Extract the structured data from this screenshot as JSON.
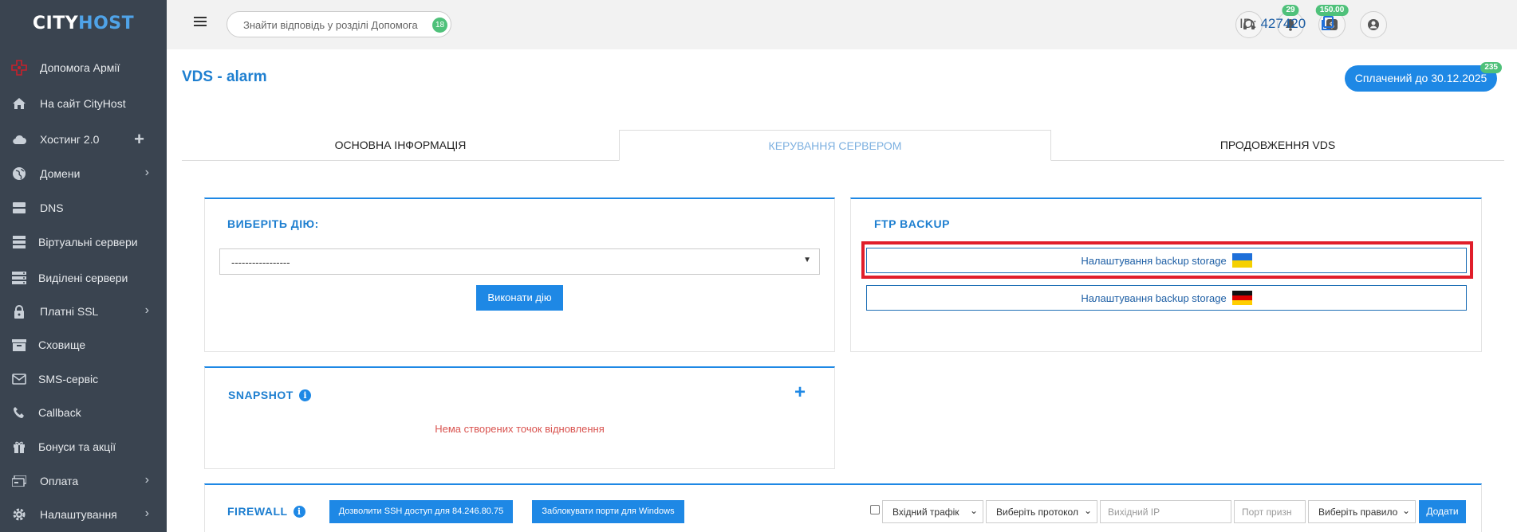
{
  "brand": {
    "part1": "CITY",
    "part2": "HOST"
  },
  "sidebar": {
    "items": [
      {
        "label": "Допомога Армії",
        "icon": "army-cross-icon"
      },
      {
        "label": "На сайт CityHost",
        "icon": "home-icon"
      },
      {
        "label": "Хостинг 2.0",
        "icon": "cloud-icon"
      },
      {
        "label": "Домени",
        "icon": "globe-icon"
      },
      {
        "label": "DNS",
        "icon": "dns-server-icon"
      },
      {
        "label": "Віртуальні сервери",
        "icon": "server-icon"
      },
      {
        "label": "Виділені сервери",
        "icon": "dedicated-server-icon"
      },
      {
        "label": "Платні SSL",
        "icon": "lock-icon"
      },
      {
        "label": "Сховище",
        "icon": "archive-box-icon"
      },
      {
        "label": "SMS-сервіс",
        "icon": "envelope-icon"
      },
      {
        "label": "Callback",
        "icon": "phone-icon"
      },
      {
        "label": "Бонуси та акції",
        "icon": "gift-icon"
      },
      {
        "label": "Оплата",
        "icon": "payment-icon"
      },
      {
        "label": "Налаштування",
        "icon": "gear-icon"
      }
    ]
  },
  "topbar": {
    "search_placeholder": "Знайти відповідь у розділі Допомога",
    "search_count": "18",
    "notifications_count": "29",
    "balance": "150.00",
    "id_label": "ID:",
    "id_value": "427420"
  },
  "page": {
    "title": "VDS - alarm",
    "paid_until": "Сплачений до 30.12.2025",
    "paid_days": "235"
  },
  "tabs": [
    "ОСНОВНА ІНФОРМАЦІЯ",
    "КЕРУВАННЯ СЕРВЕРОМ",
    "ПРОДОВЖЕННЯ VDS"
  ],
  "action_panel": {
    "title": "ВИБЕРІТЬ ДІЮ:",
    "select_value": "-----------------",
    "execute_label": "Виконати дію"
  },
  "ftp_panel": {
    "title": "FTP BACKUP",
    "btn_ua": "Налаштування backup storage",
    "btn_de": "Налаштування backup storage"
  },
  "snapshot_panel": {
    "title": "SNAPSHOT",
    "empty_message": "Нема створених точок відновлення"
  },
  "firewall": {
    "title": "FIREWALL",
    "ssh_btn": "Дозволити SSH доступ для 84.246.80.75",
    "block_btn": "Заблокувати порти для Windows",
    "traffic_select": "Вхідний трафік",
    "protocol_select": "Виберіть протокол",
    "source_ip_placeholder": "Вихідний IP",
    "port_placeholder": "Порт призн",
    "rule_select": "Виберіть правило",
    "add_btn": "Додати"
  },
  "colors": {
    "accent": "#1e88e5",
    "sidebar": "#3a4450",
    "success": "#4fc17a",
    "highlight": "#e01e2a",
    "error": "#d9534f"
  }
}
